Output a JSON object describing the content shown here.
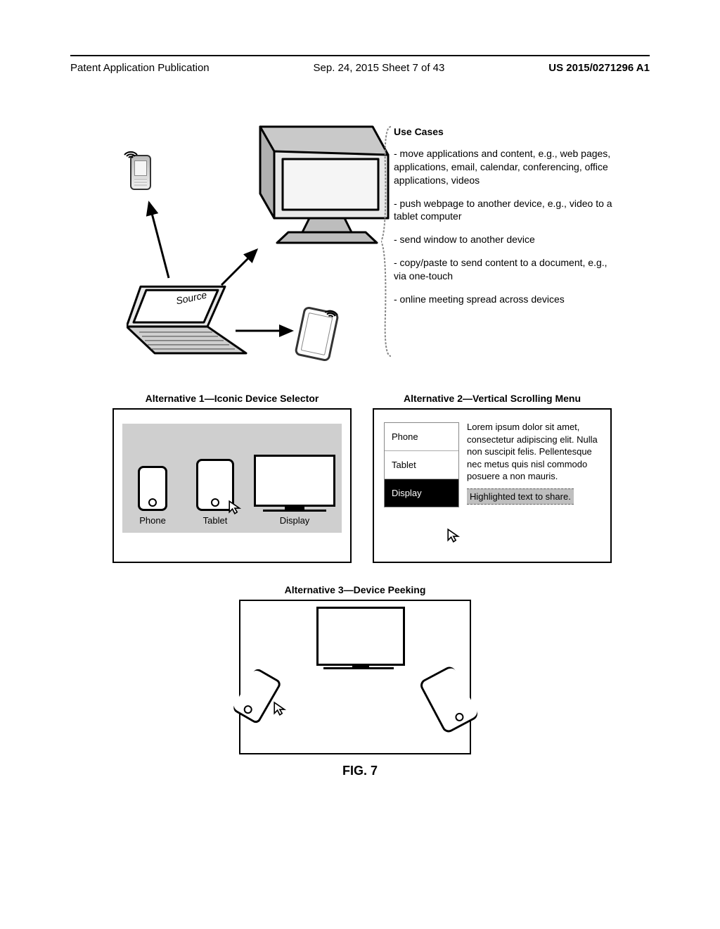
{
  "header": {
    "left": "Patent Application Publication",
    "center": "Sep. 24, 2015  Sheet 7 of 43",
    "right": "US 2015/0271296 A1"
  },
  "hero": {
    "source_label": "Source"
  },
  "usecases": {
    "title": "Use Cases",
    "items": [
      "- move applications and content, e.g., web pages, applications, email, calendar, conferencing, office applications, videos",
      "- push webpage to another device, e.g., video to a tablet computer",
      "- send window to another device",
      "- copy/paste to send content to a document, e.g., via one-touch",
      "- online meeting spread across devices"
    ]
  },
  "alt1": {
    "title": "Alternative 1—Iconic Device Selector",
    "phone": "Phone",
    "tablet": "Tablet",
    "display": "Display"
  },
  "alt2": {
    "title": "Alternative 2—Vertical Scrolling Menu",
    "menu": {
      "phone": "Phone",
      "tablet": "Tablet",
      "display": "Display"
    },
    "body": "Lorem ipsum dolor sit amet, consectetur adipiscing elit. Nulla non suscipit felis. Pellentesque nec metus quis nisl commodo posuere a non mauris.",
    "highlight": "Highlighted text to share."
  },
  "alt3": {
    "title": "Alternative 3—Device Peeking"
  },
  "figure": "FIG. 7"
}
